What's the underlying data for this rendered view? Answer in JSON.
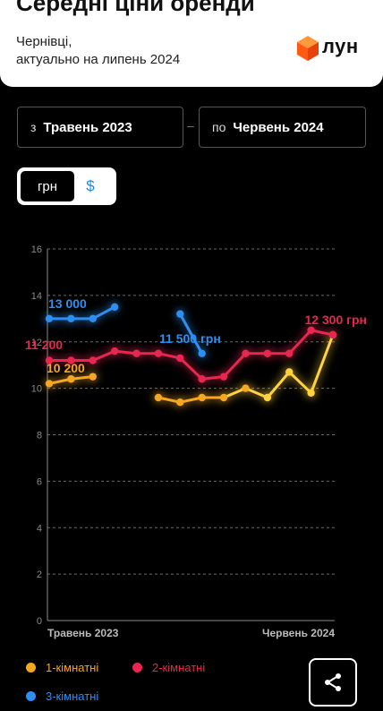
{
  "header": {
    "title": "Середні ціни оренди",
    "city": "Чернівці,",
    "updated": "актуально на липень 2024",
    "logo_text": "лун"
  },
  "range": {
    "from_prefix": "з",
    "from_value": "Травень 2023",
    "to_prefix": "по",
    "to_value": "Червень 2024",
    "separator": "–"
  },
  "currency": {
    "uah_label": "грн",
    "usd_label": "$",
    "selected": "грн"
  },
  "legend": [
    {
      "label": "1-кімнатні",
      "color": "#f5a623"
    },
    {
      "label": "2-кімнатні",
      "color": "#e8264f"
    },
    {
      "label": "3-кімнатні",
      "color": "#2f8ff0"
    }
  ],
  "share_icon": "share-icon",
  "chart_data": {
    "type": "line",
    "x": [
      "Травень 2023",
      "",
      "",
      "",
      "",
      "",
      "",
      "",
      "",
      "",
      "",
      "",
      "",
      "Червень 2024"
    ],
    "x_tick_labels": [
      "Травень 2023",
      "Червень 2024"
    ],
    "y_ticks": [
      "0",
      "2",
      "4",
      "6",
      "8",
      "10",
      "12",
      "14",
      "16"
    ],
    "ylim": [
      0,
      16
    ],
    "grid": true,
    "series": [
      {
        "name": "1-кімнатні",
        "color": "#f5a623",
        "end_color": "#ffd23f",
        "values": [
          10.2,
          10.4,
          10.5,
          null,
          null,
          9.6,
          9.4,
          9.6,
          9.6,
          10.0,
          9.6,
          10.7,
          9.8,
          12.3
        ]
      },
      {
        "name": "2-кімнатні",
        "color": "#e8264f",
        "values": [
          11.2,
          11.2,
          11.2,
          11.6,
          11.5,
          11.5,
          11.3,
          10.4,
          10.5,
          11.5,
          11.5,
          11.5,
          12.5,
          12.3
        ]
      },
      {
        "name": "3-кімнатні",
        "color": "#2f8ff0",
        "values": [
          13.0,
          13.0,
          13.0,
          13.5,
          null,
          null,
          13.2,
          11.5,
          null,
          null,
          null,
          null,
          null,
          null
        ]
      }
    ],
    "annotations": [
      {
        "text": "13 000",
        "color": "#2f8ff0"
      },
      {
        "text": "11 200",
        "color": "#e8264f"
      },
      {
        "text": "10 200",
        "color": "#f5a623"
      },
      {
        "text": "11 500 грн",
        "color": "#2f8ff0"
      },
      {
        "text": "12 300 грн",
        "color": "#e8264f"
      }
    ]
  }
}
